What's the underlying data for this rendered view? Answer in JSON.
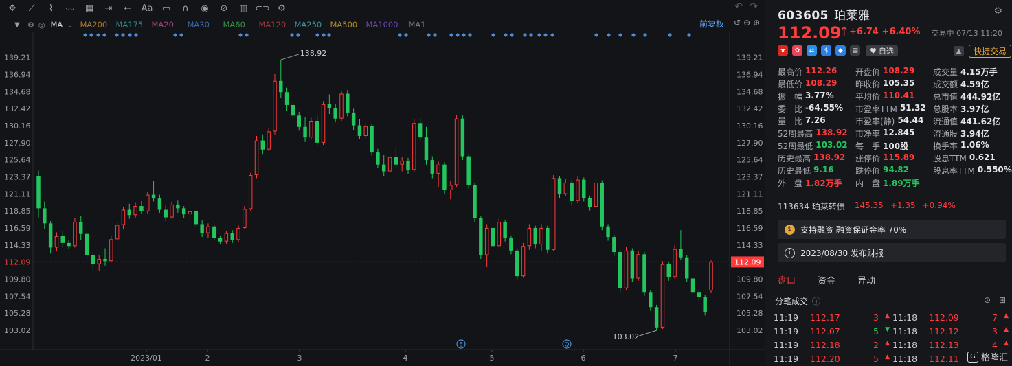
{
  "toolbar": {
    "ma_label": "MA",
    "ma_lines": [
      {
        "label": "MA200",
        "color": "#b07a2a"
      },
      {
        "label": "MA175",
        "color": "#2f8a8a"
      },
      {
        "label": "MA20",
        "color": "#a0457a"
      },
      {
        "label": "MA30",
        "color": "#3b6aa8"
      },
      {
        "label": "MA60",
        "color": "#3a8f4a"
      },
      {
        "label": "MA120",
        "color": "#a33a3a"
      },
      {
        "label": "MA250",
        "color": "#3a9a9a"
      },
      {
        "label": "MA500",
        "color": "#b08a2a"
      },
      {
        "label": "MA1000",
        "color": "#6a4aa8"
      },
      {
        "label": "MA1",
        "color": "#777777"
      }
    ],
    "adjust_label": "前复权"
  },
  "chart_data": {
    "type": "candlestick",
    "y_ticks": [
      "139.21",
      "136.94",
      "134.68",
      "132.42",
      "130.16",
      "127.90",
      "125.64",
      "123.37",
      "121.11",
      "118.85",
      "116.59",
      "114.33",
      "112.09",
      "109.80",
      "107.54",
      "105.28",
      "103.02"
    ],
    "x_ticks": [
      "2023/01",
      "2",
      "3",
      "4",
      "5",
      "6",
      "7"
    ],
    "ylim": [
      101.2,
      141.0
    ],
    "current_price": 112.09,
    "high_label": "138.92",
    "low_label": "103.02",
    "event_markers": [
      "E",
      "Q"
    ],
    "up_color": "#ff3b3b",
    "down_color": "#22c55e",
    "candles": [
      [
        123.5,
        124.2,
        118.0,
        119.2
      ],
      [
        119.2,
        120.1,
        116.5,
        117.2
      ],
      [
        117.2,
        117.5,
        113.2,
        114.0
      ],
      [
        114.0,
        116.0,
        113.5,
        115.5
      ],
      [
        115.5,
        116.2,
        114.0,
        114.6
      ],
      [
        114.6,
        115.0,
        113.8,
        114.2
      ],
      [
        114.2,
        117.9,
        114.0,
        117.4
      ],
      [
        117.4,
        118.2,
        115.0,
        115.8
      ],
      [
        115.8,
        116.1,
        112.5,
        113.0
      ],
      [
        113.0,
        113.4,
        111.0,
        111.8
      ],
      [
        111.8,
        113.0,
        110.9,
        112.5
      ],
      [
        112.5,
        113.9,
        111.6,
        112.2
      ],
      [
        112.2,
        115.6,
        112.0,
        115.1
      ],
      [
        115.1,
        117.4,
        114.9,
        117.0
      ],
      [
        117.0,
        119.4,
        116.5,
        119.0
      ],
      [
        119.0,
        119.8,
        117.8,
        118.3
      ],
      [
        118.3,
        120.0,
        117.9,
        119.5
      ],
      [
        119.5,
        120.2,
        118.4,
        118.8
      ],
      [
        118.8,
        121.4,
        118.5,
        121.0
      ],
      [
        121.0,
        122.8,
        120.1,
        120.5
      ],
      [
        120.5,
        121.0,
        118.6,
        119.0
      ],
      [
        119.0,
        119.6,
        117.5,
        118.0
      ],
      [
        118.0,
        120.1,
        117.8,
        119.7
      ],
      [
        119.7,
        120.3,
        118.6,
        119.2
      ],
      [
        119.2,
        119.5,
        117.9,
        118.4
      ],
      [
        118.4,
        119.1,
        117.3,
        118.8
      ],
      [
        118.8,
        119.0,
        116.8,
        117.1
      ],
      [
        117.1,
        117.6,
        115.4,
        115.9
      ],
      [
        115.9,
        117.2,
        115.3,
        116.8
      ],
      [
        116.8,
        117.0,
        115.0,
        115.3
      ],
      [
        115.3,
        115.6,
        114.4,
        114.8
      ],
      [
        114.8,
        116.2,
        114.5,
        115.9
      ],
      [
        115.9,
        116.3,
        114.6,
        115.0
      ],
      [
        115.0,
        117.0,
        114.7,
        116.6
      ],
      [
        116.6,
        119.5,
        116.4,
        119.1
      ],
      [
        119.1,
        123.9,
        118.9,
        123.6
      ],
      [
        123.6,
        128.8,
        123.2,
        128.2
      ],
      [
        128.2,
        129.0,
        126.4,
        127.0
      ],
      [
        127.0,
        129.9,
        126.8,
        129.4
      ],
      [
        129.4,
        137.0,
        129.0,
        136.1
      ],
      [
        136.1,
        138.9,
        133.8,
        134.6
      ],
      [
        134.6,
        135.2,
        132.1,
        132.9
      ],
      [
        132.9,
        133.4,
        131.0,
        131.5
      ],
      [
        131.5,
        132.0,
        129.5,
        130.0
      ],
      [
        130.0,
        131.3,
        128.0,
        128.6
      ],
      [
        128.6,
        131.2,
        128.3,
        130.8
      ],
      [
        130.8,
        131.5,
        127.6,
        127.9
      ],
      [
        127.9,
        133.4,
        127.6,
        133.0
      ],
      [
        133.0,
        134.3,
        131.7,
        132.5
      ],
      [
        132.5,
        133.0,
        130.6,
        131.1
      ],
      [
        131.1,
        134.8,
        130.8,
        134.4
      ],
      [
        134.4,
        134.9,
        131.4,
        131.9
      ],
      [
        131.9,
        132.4,
        129.6,
        130.2
      ],
      [
        130.2,
        131.0,
        128.4,
        128.8
      ],
      [
        128.8,
        130.5,
        128.5,
        130.1
      ],
      [
        130.1,
        130.4,
        126.2,
        126.6
      ],
      [
        126.6,
        127.1,
        124.6,
        125.0
      ],
      [
        125.0,
        126.3,
        123.5,
        124.1
      ],
      [
        124.1,
        126.5,
        123.9,
        126.0
      ],
      [
        126.0,
        127.2,
        124.5,
        125.0
      ],
      [
        125.0,
        126.0,
        124.1,
        125.5
      ],
      [
        125.5,
        125.9,
        123.7,
        124.3
      ],
      [
        124.3,
        131.0,
        124.0,
        130.5
      ],
      [
        130.5,
        131.2,
        128.2,
        128.6
      ],
      [
        128.6,
        130.0,
        125.0,
        125.6
      ],
      [
        125.6,
        126.1,
        123.2,
        123.8
      ],
      [
        123.8,
        125.4,
        122.0,
        125.0
      ],
      [
        125.0,
        125.3,
        121.1,
        121.6
      ],
      [
        121.6,
        122.8,
        120.4,
        122.3
      ],
      [
        122.3,
        131.6,
        122.0,
        131.1
      ],
      [
        131.1,
        131.6,
        125.6,
        126.1
      ],
      [
        126.1,
        126.4,
        121.8,
        122.3
      ],
      [
        122.3,
        122.6,
        117.4,
        117.9
      ],
      [
        117.9,
        118.2,
        112.5,
        113.0
      ],
      [
        113.0,
        117.1,
        111.4,
        116.6
      ],
      [
        116.6,
        117.1,
        113.7,
        114.2
      ],
      [
        114.2,
        117.9,
        114.0,
        117.4
      ],
      [
        117.4,
        117.7,
        114.8,
        115.3
      ],
      [
        115.3,
        115.6,
        113.1,
        113.6
      ],
      [
        113.6,
        113.9,
        109.7,
        110.2
      ],
      [
        110.2,
        114.6,
        110.0,
        114.2
      ],
      [
        114.2,
        117.1,
        113.7,
        116.6
      ],
      [
        116.6,
        116.9,
        113.9,
        114.4
      ],
      [
        114.4,
        117.1,
        113.6,
        116.6
      ],
      [
        116.6,
        116.9,
        113.2,
        113.7
      ],
      [
        113.7,
        123.6,
        113.5,
        123.2
      ],
      [
        123.2,
        123.5,
        120.6,
        121.1
      ],
      [
        121.1,
        123.1,
        120.8,
        122.6
      ],
      [
        122.6,
        122.9,
        119.7,
        120.2
      ],
      [
        120.2,
        123.5,
        119.9,
        123.0
      ],
      [
        123.0,
        123.3,
        120.1,
        120.6
      ],
      [
        120.6,
        120.9,
        118.9,
        119.4
      ],
      [
        119.4,
        123.1,
        119.1,
        122.6
      ],
      [
        122.6,
        122.9,
        116.3,
        116.8
      ],
      [
        116.8,
        117.1,
        114.9,
        115.4
      ],
      [
        115.4,
        115.7,
        112.9,
        113.4
      ],
      [
        113.4,
        113.7,
        108.1,
        108.6
      ],
      [
        108.6,
        114.1,
        108.3,
        113.6
      ],
      [
        113.6,
        113.9,
        109.4,
        109.9
      ],
      [
        109.9,
        113.6,
        109.6,
        113.1
      ],
      [
        113.1,
        113.4,
        107.6,
        108.1
      ],
      [
        108.1,
        108.4,
        105.6,
        106.1
      ],
      [
        106.1,
        106.4,
        103.0,
        103.4
      ],
      [
        103.4,
        112.2,
        103.2,
        111.8
      ],
      [
        111.8,
        112.1,
        109.6,
        110.1
      ],
      [
        110.1,
        114.3,
        109.8,
        113.8
      ],
      [
        113.8,
        116.3,
        112.4,
        112.7
      ],
      [
        112.7,
        113.0,
        109.4,
        109.9
      ],
      [
        109.9,
        110.2,
        107.6,
        108.1
      ],
      [
        108.1,
        108.4,
        106.8,
        107.4
      ],
      [
        107.4,
        107.7,
        105.0,
        105.4
      ],
      [
        108.3,
        112.3,
        108.0,
        112.1
      ]
    ]
  },
  "stock": {
    "code": "603605",
    "name": "珀莱雅",
    "price": "112.09",
    "arrow": "↑",
    "change": "+6.74",
    "change_pct": "+6.40%",
    "trade_time": "交易中 07/13 11:20",
    "watch_label": "自选",
    "quick_trade_label": "快捷交易"
  },
  "stats": [
    [
      {
        "k": "最高价",
        "v": "112.26",
        "c": "red"
      },
      {
        "k": "开盘价",
        "v": "108.29",
        "c": "red"
      },
      {
        "k": "成交量",
        "v": "4.15万手",
        "c": "wht"
      }
    ],
    [
      {
        "k": "最低价",
        "v": "108.29",
        "c": "red"
      },
      {
        "k": "昨收价",
        "v": "105.35",
        "c": "wht"
      },
      {
        "k": "成交额",
        "v": "4.59亿",
        "c": "wht"
      }
    ],
    [
      {
        "k": "振　幅",
        "v": "3.77%",
        "c": "wht"
      },
      {
        "k": "平均价",
        "v": "110.41",
        "c": "red"
      },
      {
        "k": "总市值",
        "v": "444.92亿",
        "c": "wht"
      }
    ],
    [
      {
        "k": "委　比",
        "v": "-64.55%",
        "c": "wht"
      },
      {
        "k": "市盈率TTM",
        "v": "51.32",
        "c": "wht"
      },
      {
        "k": "总股本",
        "v": "3.97亿",
        "c": "wht"
      }
    ],
    [
      {
        "k": "量　比",
        "v": "7.26",
        "c": "wht"
      },
      {
        "k": "市盈率(静)",
        "v": "54.44",
        "c": "wht"
      },
      {
        "k": "流通值",
        "v": "441.62亿",
        "c": "wht"
      }
    ],
    [
      {
        "k": "52周最高",
        "v": "138.92",
        "c": "red"
      },
      {
        "k": "市净率",
        "v": "12.845",
        "c": "wht"
      },
      {
        "k": "流通股",
        "v": "3.94亿",
        "c": "wht"
      }
    ],
    [
      {
        "k": "52周最低",
        "v": "103.02",
        "c": "green"
      },
      {
        "k": "每　手",
        "v": "100股",
        "c": "wht"
      },
      {
        "k": "换手率",
        "v": "1.06%",
        "c": "wht"
      }
    ],
    [
      {
        "k": "历史最高",
        "v": "138.92",
        "c": "red"
      },
      {
        "k": "涨停价",
        "v": "115.89",
        "c": "red"
      },
      {
        "k": "股息TTM",
        "v": "0.621",
        "c": "wht"
      }
    ],
    [
      {
        "k": "历史最低",
        "v": "9.16",
        "c": "green"
      },
      {
        "k": "跌停价",
        "v": "94.82",
        "c": "green"
      },
      {
        "k": "股息率TTM",
        "v": "0.550%",
        "c": "wht"
      }
    ],
    [
      {
        "k": "外　盘",
        "v": "1.82万手",
        "c": "red"
      },
      {
        "k": "内　盘",
        "v": "1.89万手",
        "c": "green"
      },
      {
        "k": "",
        "v": "",
        "c": "wht"
      }
    ]
  ],
  "bond": {
    "code": "113634",
    "name": "珀莱转债",
    "price": "145.35",
    "change": "+1.35",
    "change_pct": "+0.94%"
  },
  "info": {
    "margin": "支持融资 融资保证金率 70%",
    "report": "2023/08/30  发布财报"
  },
  "tabs": [
    {
      "label": "盘口",
      "active": true
    },
    {
      "label": "资金",
      "active": false
    },
    {
      "label": "异动",
      "active": false
    }
  ],
  "trades_title": "分笔成交",
  "trades": [
    [
      {
        "t": "11:19",
        "p": "112.17",
        "q": "3",
        "dir": "up"
      },
      {
        "t": "11:18",
        "p": "112.09",
        "q": "7",
        "dir": "up"
      }
    ],
    [
      {
        "t": "11:19",
        "p": "112.07",
        "q": "5",
        "dir": "down"
      },
      {
        "t": "11:18",
        "p": "112.12",
        "q": "3",
        "dir": "up"
      }
    ],
    [
      {
        "t": "11:19",
        "p": "112.18",
        "q": "2",
        "dir": "up"
      },
      {
        "t": "11:18",
        "p": "112.13",
        "q": "4",
        "dir": "up"
      }
    ],
    [
      {
        "t": "11:19",
        "p": "112.20",
        "q": "5",
        "dir": "up"
      },
      {
        "t": "11:18",
        "p": "112.11",
        "q": "",
        "dir": "none"
      }
    ]
  ],
  "watermark": "格隆汇"
}
